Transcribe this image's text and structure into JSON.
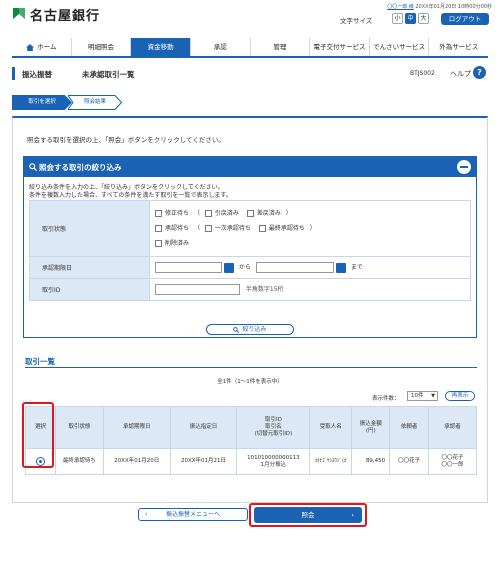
{
  "header": {
    "bank_name": "名古屋銀行",
    "user_name": "〇〇一郎 様",
    "login_time": "20XX年01月20日 10時00分00秒",
    "text_size_label": "文字サイズ",
    "sizes": [
      "小",
      "中",
      "大"
    ],
    "logout": "ログアウト"
  },
  "nav": {
    "items": [
      {
        "label": "ホーム"
      },
      {
        "label": "明細照会"
      },
      {
        "label": "資金移動"
      },
      {
        "label": "承認"
      },
      {
        "label": "管理"
      },
      {
        "label": "電子交付サービス"
      },
      {
        "label": "でんさいサービス"
      },
      {
        "label": "外為サービス"
      }
    ]
  },
  "title": {
    "section": "振込振替",
    "page": "未承認取引一覧",
    "screen_id": "BTJS002",
    "help": "ヘルプ"
  },
  "steps": [
    "取引を選択",
    "照会結果"
  ],
  "intro": "照会する取引を選択の上、「照会」ボタンをクリックしてください。",
  "filter": {
    "title": "照会する取引の絞り込み",
    "note1": "絞り込み条件を入力の上、「絞り込み」ボタンをクリックしてください。",
    "note2": "条件を複数入力した場合、すべての条件を満たす取引を一覧で表示します。",
    "status_label": "取引状態",
    "status_line1": {
      "a": "修正待ち",
      "b": "引戻済み",
      "c": "差戻済み"
    },
    "status_line2": {
      "a": "承認待ち",
      "b": "一次承認待ち",
      "c": "最終承認待ち"
    },
    "status_line3": "削除済み",
    "date_label": "承認期限日",
    "date_from": "から",
    "date_to": "まで",
    "id_label": "取引ID",
    "id_hint": "半角数字15桁",
    "button": "絞り込み"
  },
  "list": {
    "title": "取引一覧",
    "count": "全1件（1～1件を表示中）",
    "per_page_label": "表示件数：",
    "per_page_value": "10件",
    "redisplay": "再表示",
    "columns": [
      "選択",
      "取引状態",
      "承認期限日",
      "振込指定日",
      "取引ID\n取引名\n(切替元取引ID)",
      "受取人名",
      "振込金額\n(円)",
      "依頼者",
      "承認者"
    ],
    "rows": [
      {
        "status": "最終承認待ち",
        "deadline": "20XX年01月20日",
        "transfer_date": "20XX年01月21日",
        "trade_id": "101010000000113",
        "trade_name": "1月分振込",
        "payee": "ｶ)ﾅｺﾞﾔｼﾖｳｼﾞ(ｶ",
        "amount": "89,450",
        "requester": "〇〇花子",
        "approver1": "〇〇花子",
        "approver2": "〇〇一郎"
      }
    ]
  },
  "buttons": {
    "back": "振込振替メニューへ",
    "refer": "照会"
  },
  "colors": {
    "primary": "#1a62b3",
    "header_cell": "#dce8f6",
    "highlight": "#e0161f"
  }
}
